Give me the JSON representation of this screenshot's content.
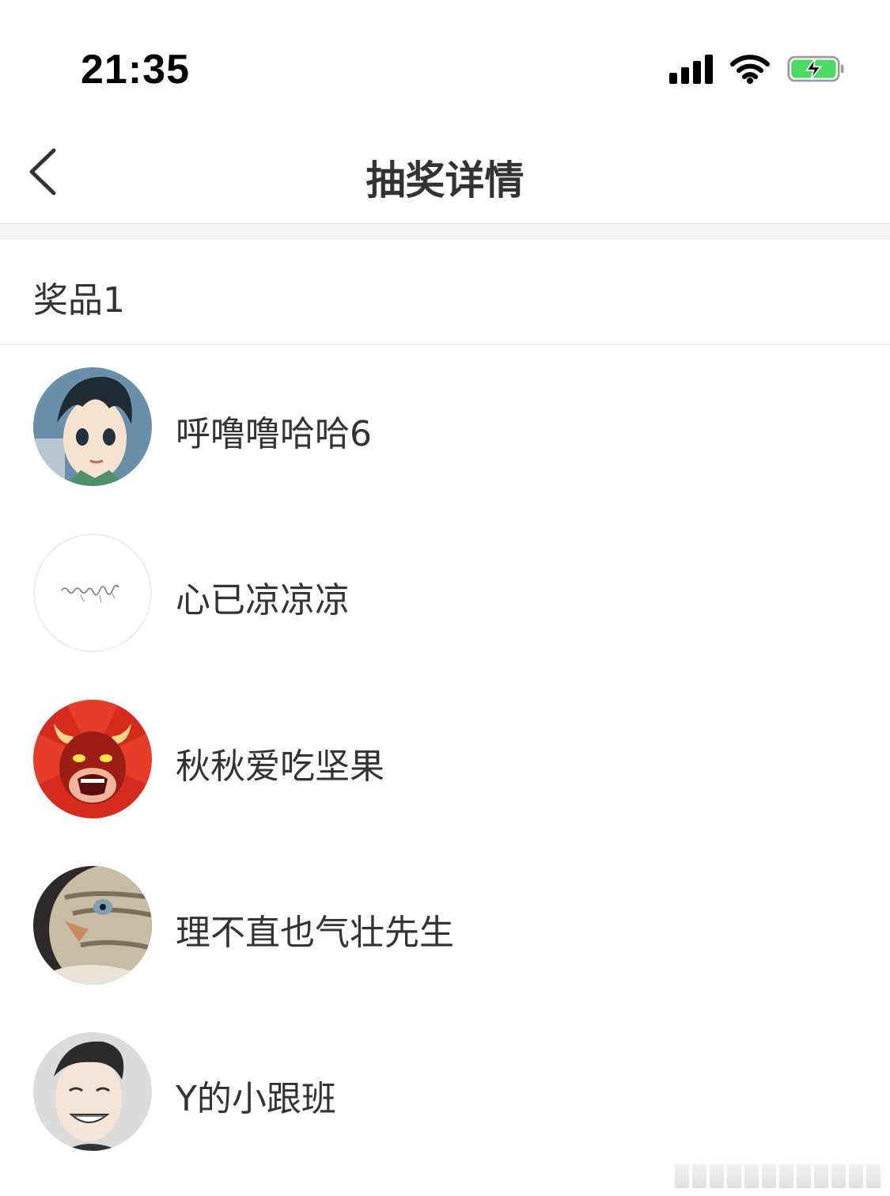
{
  "status_bar": {
    "time": "21:35",
    "icons": [
      "cellular-signal-icon",
      "wifi-icon",
      "battery-charging-icon"
    ],
    "battery_color": "#4cd964"
  },
  "nav": {
    "title": "抽奖详情",
    "back_icon": "chevron-left-icon"
  },
  "section": {
    "label": "奖品1"
  },
  "winners": [
    {
      "name": "呼噜噜哈哈6",
      "avatar": "anime-boy-avatar"
    },
    {
      "name": "心已凉凉凉",
      "avatar": "handwriting-avatar"
    },
    {
      "name": "秋秋爱吃坚果",
      "avatar": "red-bull-avatar"
    },
    {
      "name": "理不直也气壮先生",
      "avatar": "cat-avatar"
    },
    {
      "name": "Y的小跟班",
      "avatar": "grinning-man-avatar"
    }
  ],
  "colors": {
    "text": "#333333",
    "divider": "#e6e6e6",
    "band": "#f4f4f4"
  }
}
